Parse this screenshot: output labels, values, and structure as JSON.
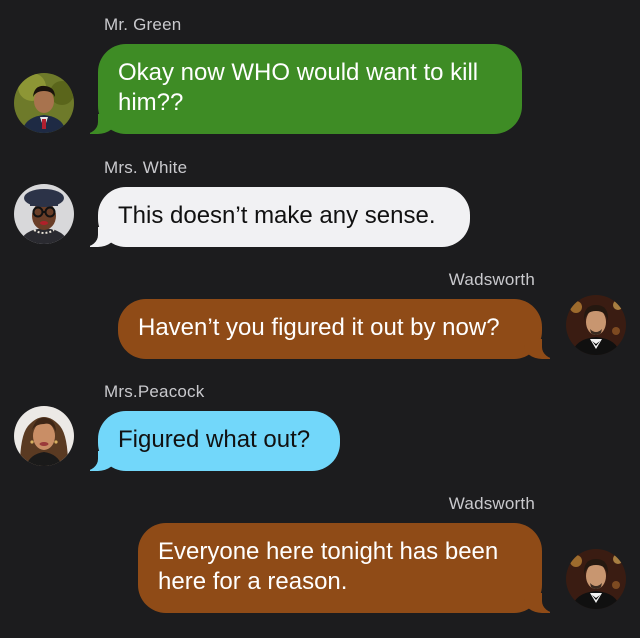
{
  "colors": {
    "background": "#1c1c1e",
    "green": "#3e8c25",
    "white": "#f1f1f3",
    "brown": "#8f4b17",
    "blue": "#72d7fa"
  },
  "messages": [
    {
      "sender": "Mr. Green",
      "text_lines": [
        "Okay now WHO would want to kill",
        "him??"
      ],
      "side": "left",
      "color": "green",
      "avatar": "mr-green-avatar"
    },
    {
      "sender": "Mrs. White",
      "text_lines": [
        "This doesn’t make any sense."
      ],
      "side": "left",
      "color": "white",
      "avatar": "mrs-white-avatar"
    },
    {
      "sender": "Wadsworth",
      "text_lines": [
        "Haven’t you figured it out by now?"
      ],
      "side": "right",
      "color": "brown",
      "avatar": "wadsworth-avatar"
    },
    {
      "sender": "Mrs.Peacock",
      "text_lines": [
        "Figured what out?"
      ],
      "side": "left",
      "color": "blue",
      "avatar": "mrs-peacock-avatar"
    },
    {
      "sender": "Wadsworth",
      "text_lines": [
        "Everyone here tonight has been",
        "here for a reason."
      ],
      "side": "right",
      "color": "brown",
      "avatar": "wadsworth-avatar"
    }
  ]
}
